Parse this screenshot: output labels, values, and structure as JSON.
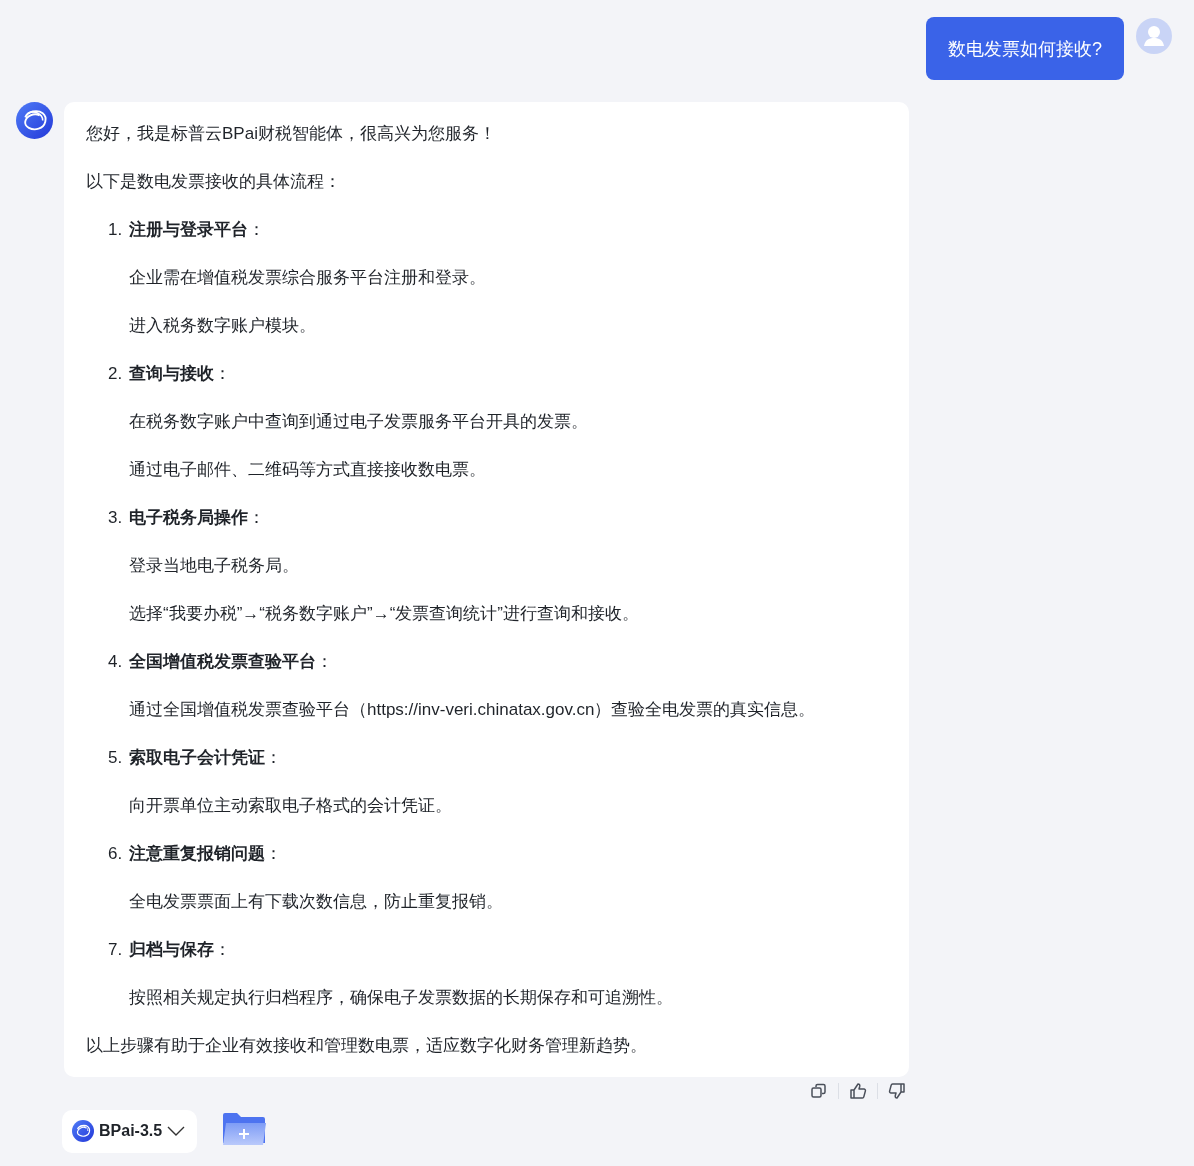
{
  "user_message": {
    "text": "数电发票如何接收?"
  },
  "reply": {
    "greeting": "您好，我是标普云BPai财税智能体，很高兴为您服务！",
    "intro": "以下是数电发票接收的具体流程：",
    "steps": [
      {
        "number": "1.",
        "title": "**注册与登录平台**：",
        "lines": [
          "企业需在增值税发票综合服务平台注册和登录。",
          "进入税务数字账户模块。"
        ]
      },
      {
        "number": "2.",
        "title": "**查询与接收**：",
        "lines": [
          "在税务数字账户中查询到通过电子发票服务平台开具的发票。",
          "通过电子邮件、二维码等方式直接接收数电票。"
        ]
      },
      {
        "number": "3.",
        "title": "**电子税务局操作**：",
        "lines": [
          "登录当地电子税务局。",
          "选择“我要办税”→“税务数字账户”→“发票查询统计”进行查询和接收。"
        ]
      },
      {
        "number": "4.",
        "title": "**全国增值税发票查验平台**：",
        "lines": [
          "通过全国增值税发票查验平台（https://inv-veri.chinatax.gov.cn）查验全电发票的真实信息。"
        ]
      },
      {
        "number": "5.",
        "title": "**索取电子会计凭证**：",
        "lines": [
          "向开票单位主动索取电子格式的会计凭证。"
        ]
      },
      {
        "number": "6.",
        "title": "**注意重复报销问题**：",
        "lines": [
          "全电发票票面上有下载次数信息，防止重复报销。"
        ]
      },
      {
        "number": "7.",
        "title": "**归档与保存**：",
        "lines": [
          "按照相关规定执行归档程序，确保电子发票数据的长期保存和可追溯性。"
        ]
      }
    ],
    "conclusion": "以上步骤有助于企业有效接收和管理数电票，适应数字化财务管理新趋势。"
  },
  "model_selector": {
    "label": "BPai-3.5"
  }
}
